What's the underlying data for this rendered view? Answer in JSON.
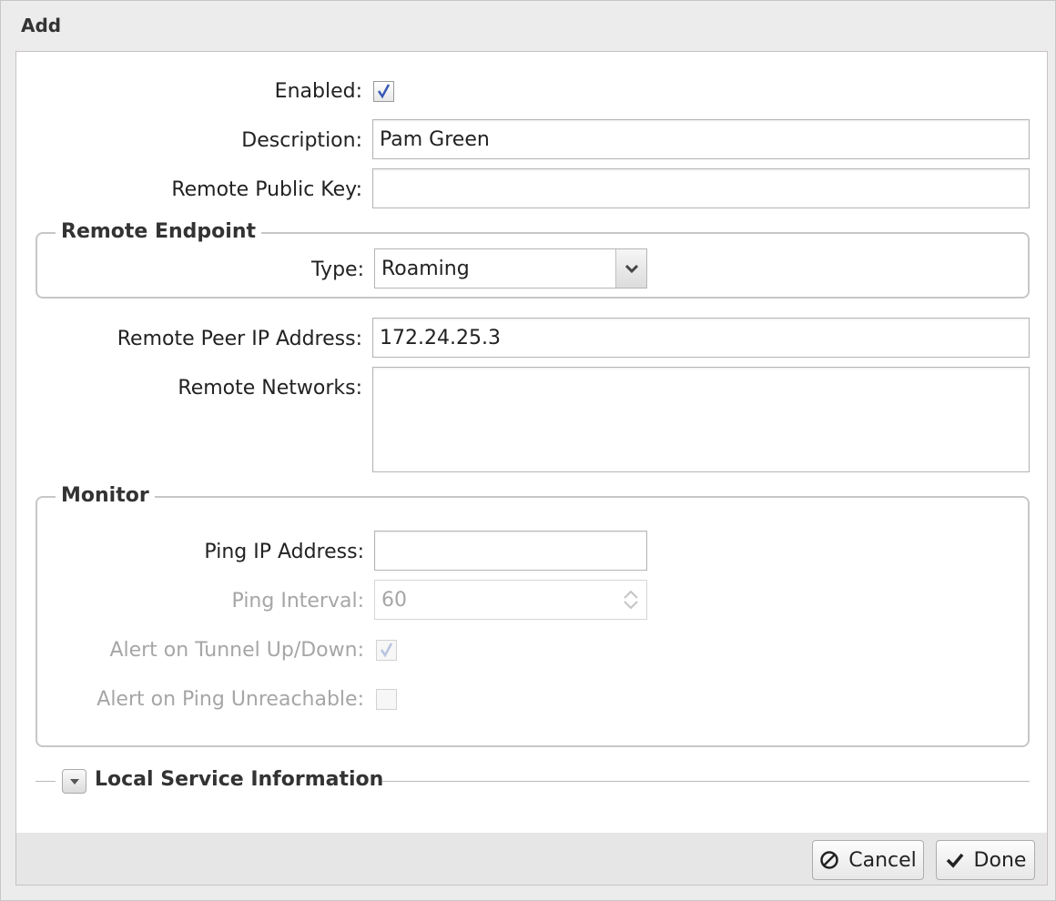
{
  "dialog": {
    "title": "Add"
  },
  "fields": {
    "enabled": {
      "label": "Enabled:",
      "checked": true
    },
    "description": {
      "label": "Description:",
      "value": "Pam Green"
    },
    "remote_public_key": {
      "label": "Remote Public Key:",
      "value": ""
    },
    "remote_peer_ip": {
      "label": "Remote Peer IP Address:",
      "value": "172.24.25.3"
    },
    "remote_networks": {
      "label": "Remote Networks:",
      "value": ""
    }
  },
  "remote_endpoint": {
    "legend": "Remote Endpoint",
    "type_label": "Type:",
    "type_value": "Roaming"
  },
  "monitor": {
    "legend": "Monitor",
    "ping_ip": {
      "label": "Ping IP Address:",
      "value": ""
    },
    "ping_interval": {
      "label": "Ping Interval:",
      "value": "60"
    },
    "alert_tunnel": {
      "label": "Alert on Tunnel Up/Down:",
      "checked": true
    },
    "alert_ping": {
      "label": "Alert on Ping Unreachable:",
      "checked": false
    }
  },
  "local_service": {
    "label": "Local Service Information",
    "collapsed": true
  },
  "footer": {
    "cancel_label": "Cancel",
    "done_label": "Done"
  },
  "colors": {
    "check": "#3b5bb5",
    "disabled_text": "#a6a6a6",
    "border": "#c7c7c7"
  },
  "icons": {
    "cancel": "ban-icon",
    "done": "checkmark-icon",
    "dropdown": "chevron-down-icon"
  }
}
